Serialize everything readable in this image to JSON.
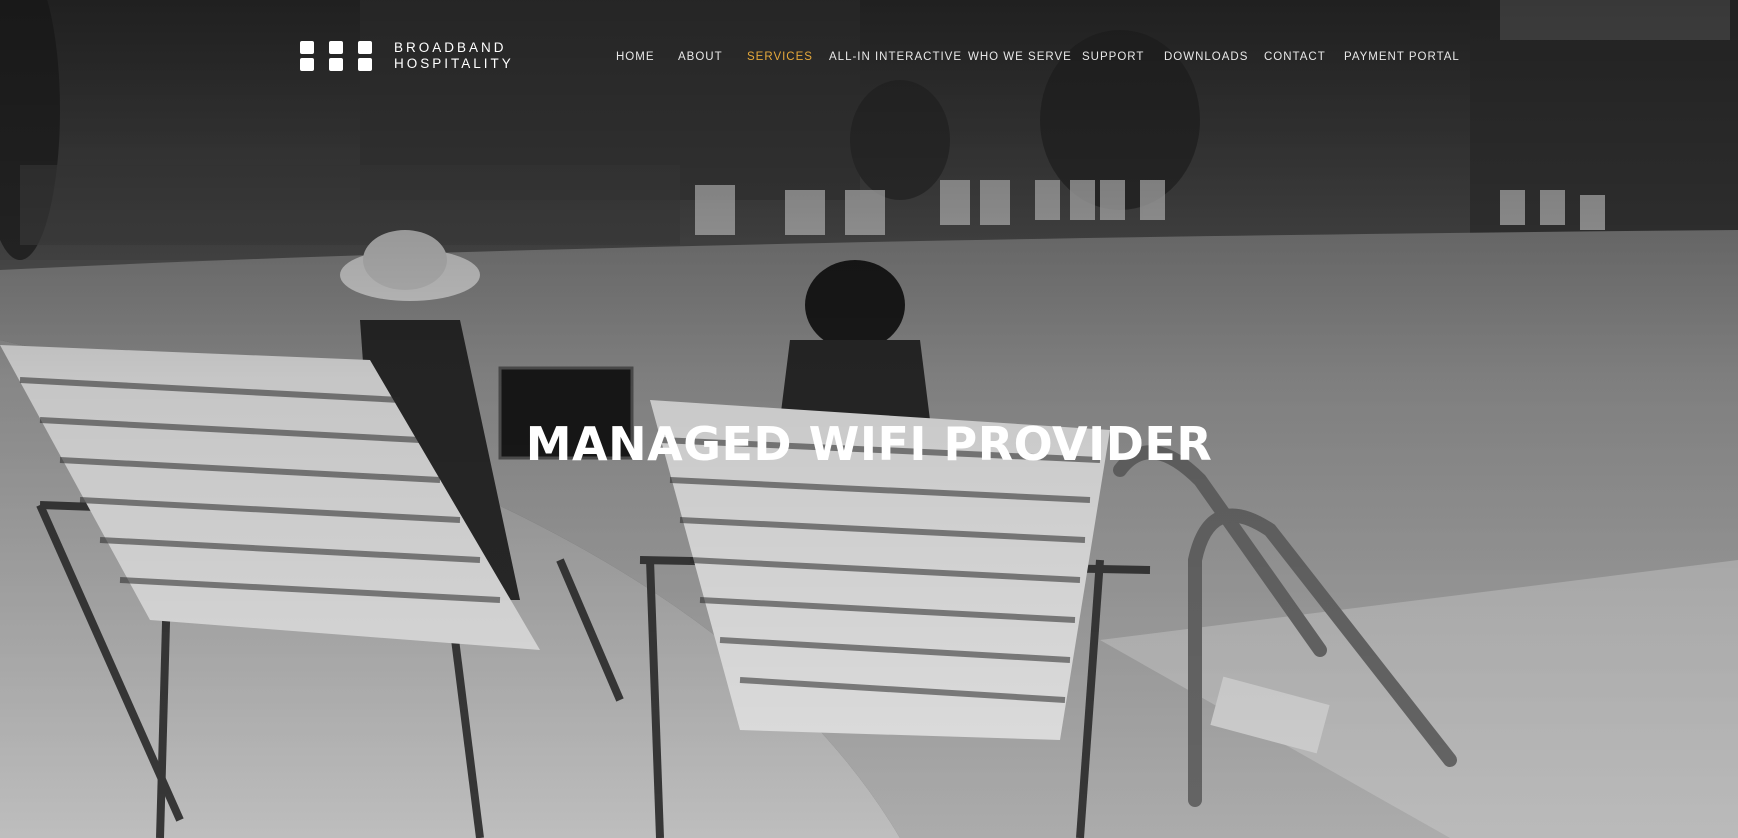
{
  "brand": {
    "line1": "BROADBAND",
    "line2": "HOSPITALITY"
  },
  "nav": {
    "items": [
      {
        "label": "HOME"
      },
      {
        "label": "ABOUT"
      },
      {
        "label": "SERVICES"
      },
      {
        "label": "ALL-IN INTERACTIVE"
      },
      {
        "label": "WHO WE SERVE"
      },
      {
        "label": "SUPPORT"
      },
      {
        "label": "DOWNLOADS"
      },
      {
        "label": "CONTACT"
      },
      {
        "label": "PAYMENT PORTAL"
      }
    ],
    "active_color": "#e6a93b"
  },
  "hero": {
    "headline": "MANAGED WIFI PROVIDER",
    "image": "grayscale-poolside-lounge-chairs-photo"
  }
}
